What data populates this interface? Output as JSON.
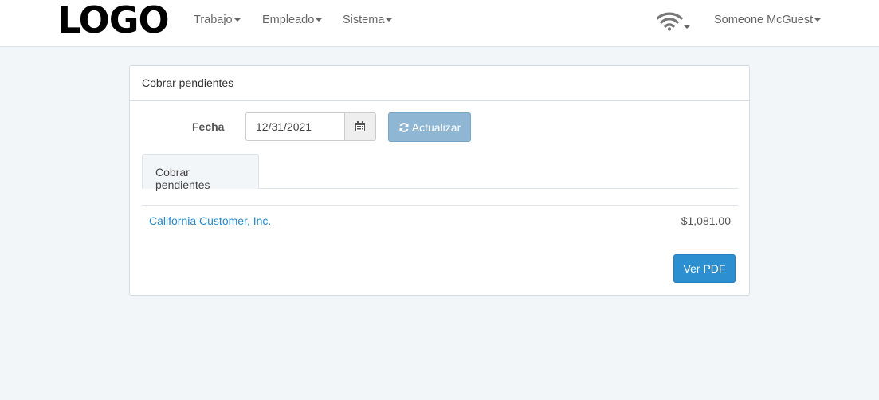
{
  "header": {
    "logo_text": "LOGO",
    "menu": [
      {
        "label": "Trabajo"
      },
      {
        "label": "Empleado"
      },
      {
        "label": "Sistema"
      }
    ],
    "user_name": "Someone McGuest",
    "connection_icon": "wifi-icon"
  },
  "panel": {
    "title": "Cobrar pendientes",
    "date_label": "Fecha",
    "date_value": "12/31/2021",
    "calendar_icon": "calendar-icon",
    "refresh_label": "Actualizar",
    "refresh_icon": "refresh-icon",
    "tab_label": "Cobrar pendientes",
    "rows": [
      {
        "customer": "California Customer, Inc.",
        "amount": "$1,081.00"
      }
    ],
    "pdf_button": "Ver PDF"
  },
  "colors": {
    "link": "#2a8ac9",
    "primary_button": "#2b8fd0",
    "refresh_button": "#8fb6d2",
    "page_background": "#f3f6f9"
  }
}
